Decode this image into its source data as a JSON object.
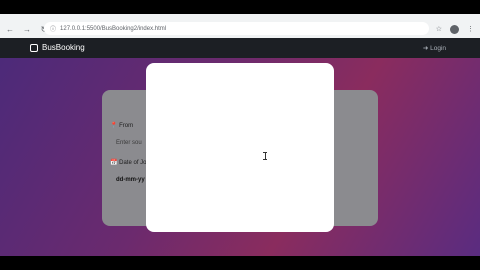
{
  "browser": {
    "url": "127.0.0.1:5500/BusBooking2/index.html",
    "back_icon": "←",
    "forward_icon": "→",
    "reload_icon": "↻",
    "lock_icon": "ⓘ",
    "star_icon": "☆",
    "profile_initial": "L",
    "menu_icon": "⋮"
  },
  "navbar": {
    "brand": "BusBooking",
    "login": "➜ Login"
  },
  "form": {
    "from_label": "📍 From",
    "from_placeholder": "Enter sou",
    "date_label": "📅 Date of Jo",
    "date_value": "dd-mm-yy"
  }
}
